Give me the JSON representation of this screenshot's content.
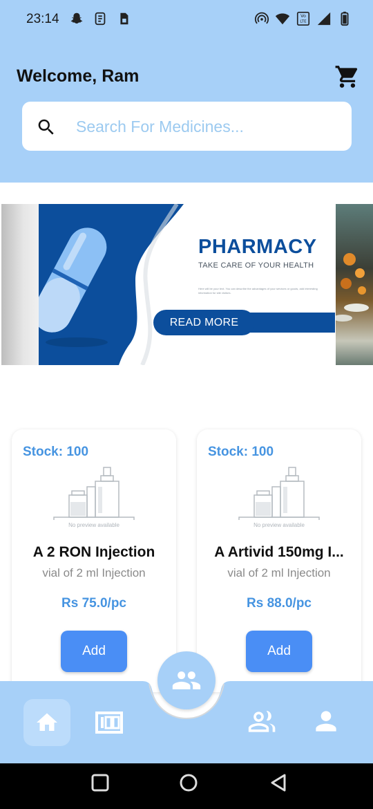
{
  "status_bar": {
    "time": "23:14",
    "left_icons": [
      "snapchat-icon",
      "sim-toolkit-icon",
      "sd-card-icon"
    ],
    "right_icons": [
      "hotspot-icon",
      "wifi-icon",
      "volte-icon",
      "signal-icon",
      "battery-icon"
    ]
  },
  "header": {
    "welcome": "Welcome, Ram",
    "cart_icon": "cart-icon"
  },
  "search": {
    "placeholder": "Search For Medicines...",
    "value": ""
  },
  "banner": {
    "title": "PHARMACY",
    "subtitle": "TAKE CARE OF YOUR HEALTH",
    "body": "Here will be your text. You can describe the advantages of your services or goods, add interesting information for site visitors.",
    "button": "READ MORE"
  },
  "products": [
    {
      "stock": "Stock: 100",
      "no_preview": "No preview available",
      "name": "A 2 RON Injection",
      "desc": "vial of 2 ml Injection",
      "price": "Rs 75.0/pc",
      "add": "Add"
    },
    {
      "stock": "Stock: 100",
      "no_preview": "No preview available",
      "name": "A Artivid 150mg I...",
      "desc": "vial of 2 ml Injection",
      "price": "Rs 88.0/pc",
      "add": "Add"
    }
  ],
  "bottom_nav": {
    "items": [
      "home-icon",
      "stock-counter-icon",
      "group-icon",
      "users-icon",
      "profile-icon"
    ],
    "active": "home-icon"
  },
  "colors": {
    "header_bg": "#a7d0f8",
    "accent_blue": "#4694e1",
    "button_blue": "#4a8ef5",
    "banner_navy": "#0c4e9c"
  }
}
